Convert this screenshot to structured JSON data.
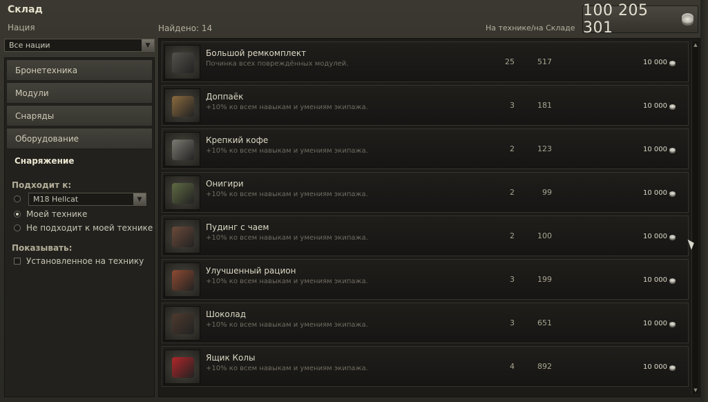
{
  "window": {
    "title": "Склад"
  },
  "header": {
    "nation_label": "Нация",
    "found_label": "Найдено: 14",
    "column_label": "На технике/на Складе",
    "gold": "100 205 301"
  },
  "nation_select": {
    "value": "Все нации"
  },
  "sidebar": {
    "categories": [
      {
        "label": "Бронетехника"
      },
      {
        "label": "Модули"
      },
      {
        "label": "Снаряды"
      },
      {
        "label": "Оборудование"
      },
      {
        "label": "Снаряжение"
      }
    ],
    "fits_label": "Подходит к:",
    "vehicle_select": "M18 Hellcat",
    "radio_my": "Моей технике",
    "radio_not": "Не подходит к моей технике",
    "show_label": "Показывать:",
    "checkbox_installed": "Установленное на технику"
  },
  "items": [
    {
      "name": "Большой ремкомплект",
      "desc": "Починка всех повреждённых модулей.",
      "on_vehicle": "25",
      "in_store": "517",
      "price": "10 000",
      "color": "#55524b"
    },
    {
      "name": "Доппаёк",
      "desc": "+10% ко всем навыкам и умениям экипажа.",
      "on_vehicle": "3",
      "in_store": "181",
      "price": "10 000",
      "color": "#8a6a3e"
    },
    {
      "name": "Крепкий кофе",
      "desc": "+10% ко всем навыкам и умениям экипажа.",
      "on_vehicle": "2",
      "in_store": "123",
      "price": "10 000",
      "color": "#7d7a72"
    },
    {
      "name": "Онигири",
      "desc": "+10% ко всем навыкам и умениям экипажа.",
      "on_vehicle": "2",
      "in_store": "99",
      "price": "10 000",
      "color": "#5f6b43"
    },
    {
      "name": "Пудинг с чаем",
      "desc": "+10% ко всем навыкам и умениям экипажа.",
      "on_vehicle": "2",
      "in_store": "100",
      "price": "10 000",
      "color": "#6b4a3a"
    },
    {
      "name": "Улучшенный рацион",
      "desc": "+10% ко всем навыкам и умениям экипажа.",
      "on_vehicle": "3",
      "in_store": "199",
      "price": "10 000",
      "color": "#8e4a32"
    },
    {
      "name": "Шоколад",
      "desc": "+10% ко всем навыкам и умениям экипажа.",
      "on_vehicle": "3",
      "in_store": "651",
      "price": "10 000",
      "color": "#4d3a2e"
    },
    {
      "name": "Ящик Колы",
      "desc": "+10% ко всем навыкам и умениям экипажа.",
      "on_vehicle": "4",
      "in_store": "892",
      "price": "10 000",
      "color": "#b0262a"
    }
  ]
}
